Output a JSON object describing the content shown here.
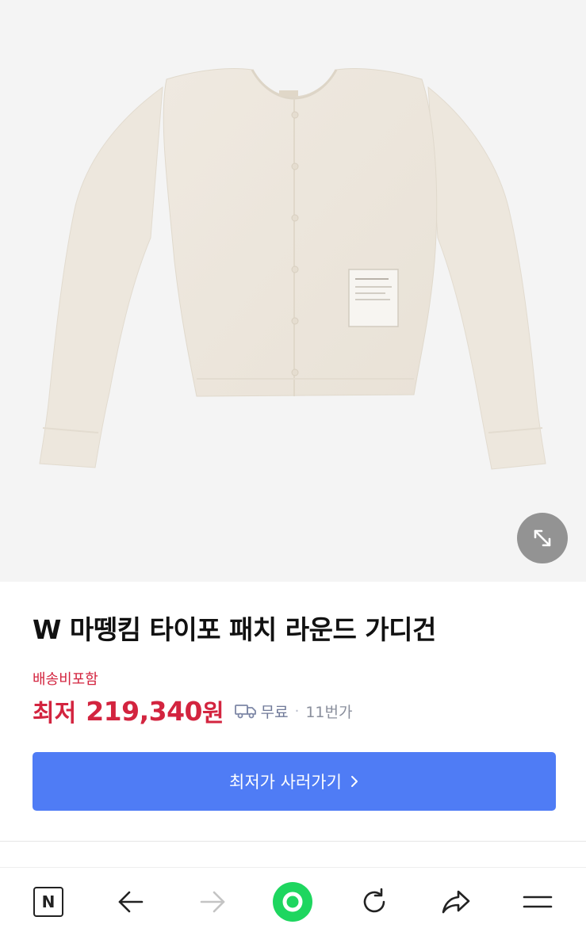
{
  "product": {
    "title": "W 마뗑킴 타이포 패치 라운드 가디건",
    "shipping_note": "배송비포함",
    "price_prefix": "최저",
    "price": "219,340",
    "price_unit": "원",
    "delivery": "무료",
    "separator": "·",
    "seller": "11번가",
    "buy_button_label": "최저가 사러가기"
  },
  "icons": {
    "zoom": "expand-icon",
    "truck": "truck-icon",
    "chevron": "chevron-right-icon"
  },
  "toolbar": {
    "items": [
      {
        "name": "naver-home-icon",
        "label": "N"
      },
      {
        "name": "back-arrow-icon"
      },
      {
        "name": "forward-arrow-icon"
      },
      {
        "name": "green-dot-icon"
      },
      {
        "name": "refresh-icon"
      },
      {
        "name": "share-icon"
      },
      {
        "name": "menu-icon"
      }
    ]
  },
  "colors": {
    "price_red": "#d3243f",
    "button_blue": "#4f7cf5",
    "green": "#1ed65f"
  }
}
